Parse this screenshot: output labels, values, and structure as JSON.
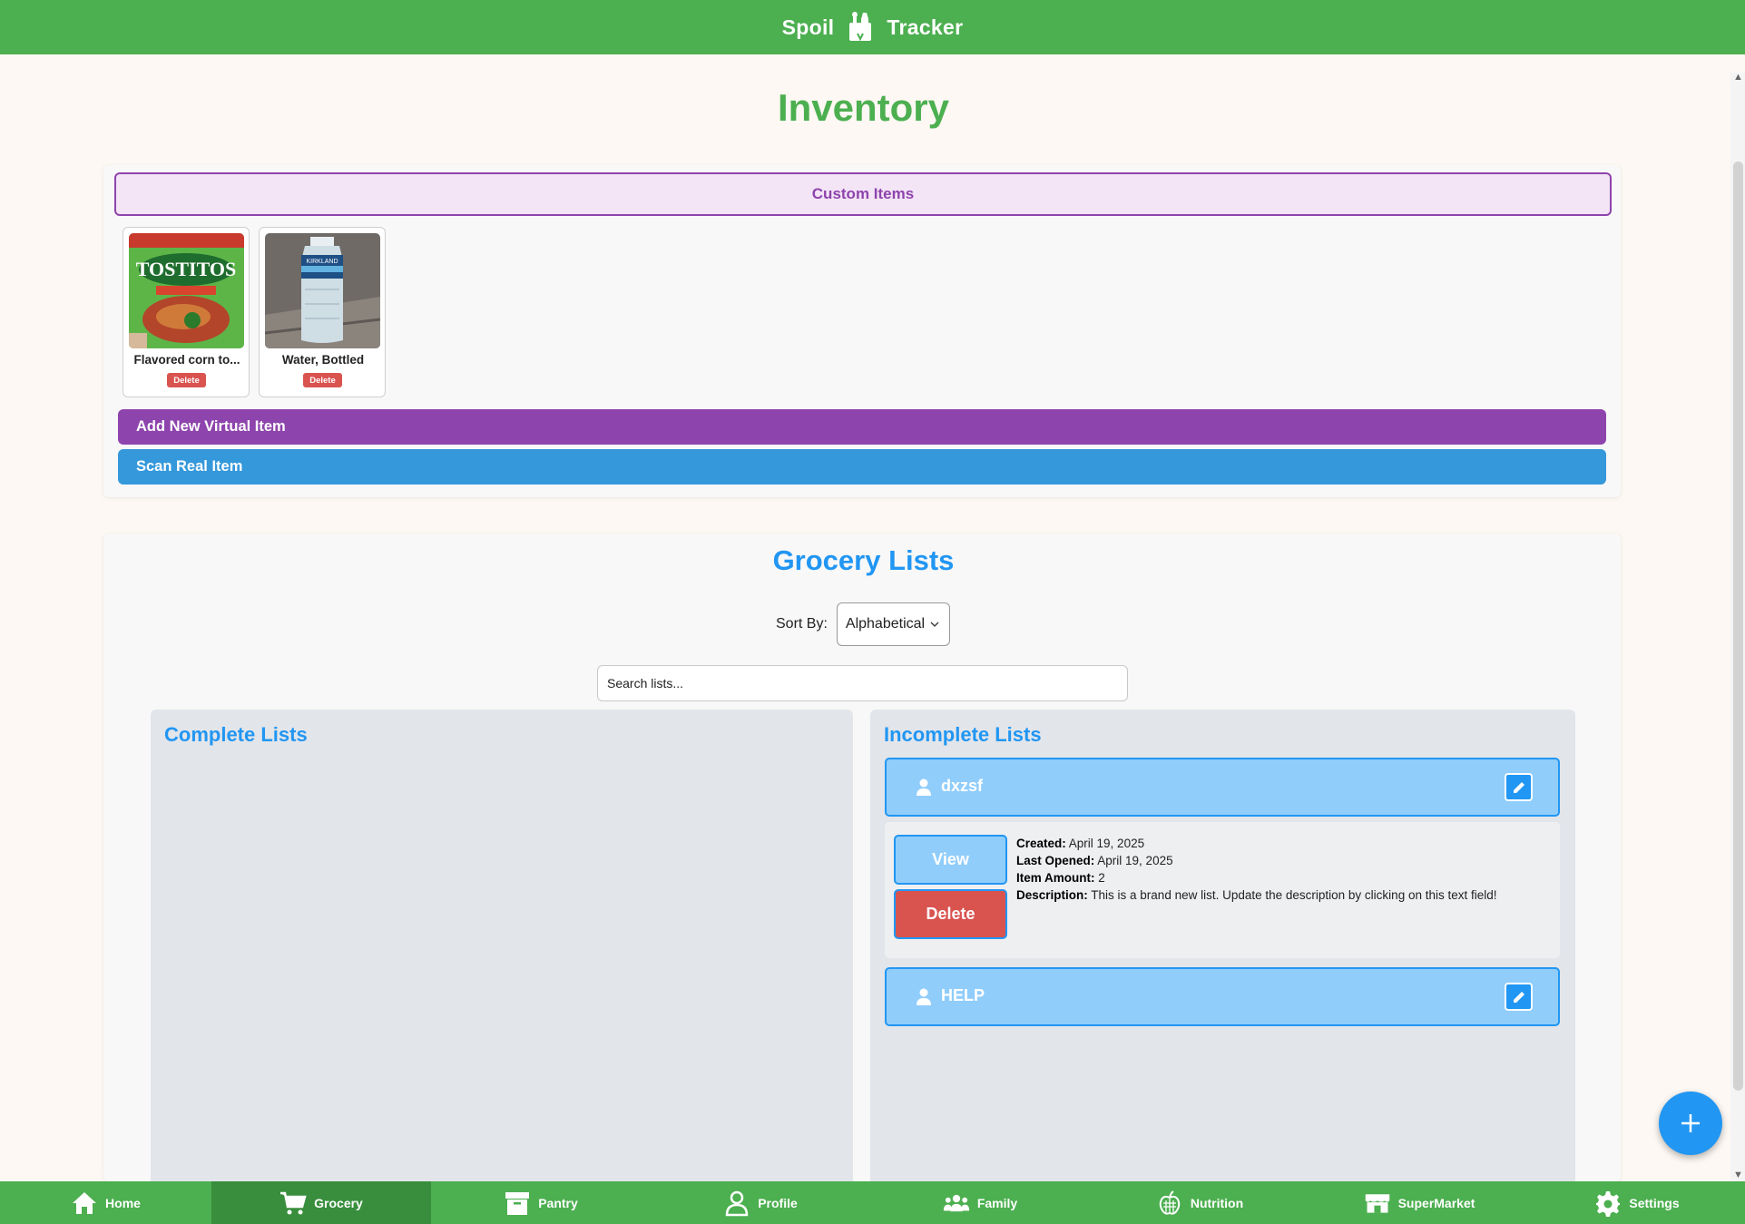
{
  "header": {
    "left_word": "Spoil",
    "right_word": "Tracker"
  },
  "page_title": "Inventory",
  "inventory": {
    "section_title": "Custom Items",
    "items": [
      {
        "name": "Flavored corn to...",
        "delete_label": "Delete",
        "image": "tostitos-bag"
      },
      {
        "name": "Water, Bottled",
        "delete_label": "Delete",
        "image": "water-bottle"
      }
    ],
    "add_virtual_label": "Add New Virtual Item",
    "scan_label": "Scan Real Item"
  },
  "grocery": {
    "title": "Grocery Lists",
    "sort_label": "Sort By:",
    "sort_value": "Alphabetical",
    "search_placeholder": "Search lists...",
    "complete_title": "Complete Lists",
    "incomplete_title": "Incomplete Lists",
    "lists": [
      {
        "name": "dxzsf",
        "view_label": "View",
        "delete_label": "Delete",
        "created_label": "Created:",
        "created": "April 19, 2025",
        "opened_label": "Last Opened:",
        "opened": "April 19, 2025",
        "amount_label": "Item Amount:",
        "amount": "2",
        "desc_label": "Description:",
        "desc": "This is a brand new list. Update the description by clicking on this text field!"
      },
      {
        "name": "HELP"
      }
    ]
  },
  "nav": [
    {
      "label": "Home",
      "icon": "home-icon"
    },
    {
      "label": "Grocery",
      "icon": "cart-icon",
      "active": true
    },
    {
      "label": "Pantry",
      "icon": "box-icon"
    },
    {
      "label": "Profile",
      "icon": "user-icon"
    },
    {
      "label": "Family",
      "icon": "family-icon"
    },
    {
      "label": "Nutrition",
      "icon": "apple-icon"
    },
    {
      "label": "SuperMarket",
      "icon": "store-icon"
    },
    {
      "label": "Settings",
      "icon": "gear-icon"
    }
  ],
  "colors": {
    "brand_green": "#4caf50",
    "active_nav": "#388e3c",
    "purple": "#8e44ad",
    "blue": "#2196f3",
    "scan_blue": "#3498db",
    "danger": "#d9534f",
    "list_header": "#90cdfb"
  }
}
